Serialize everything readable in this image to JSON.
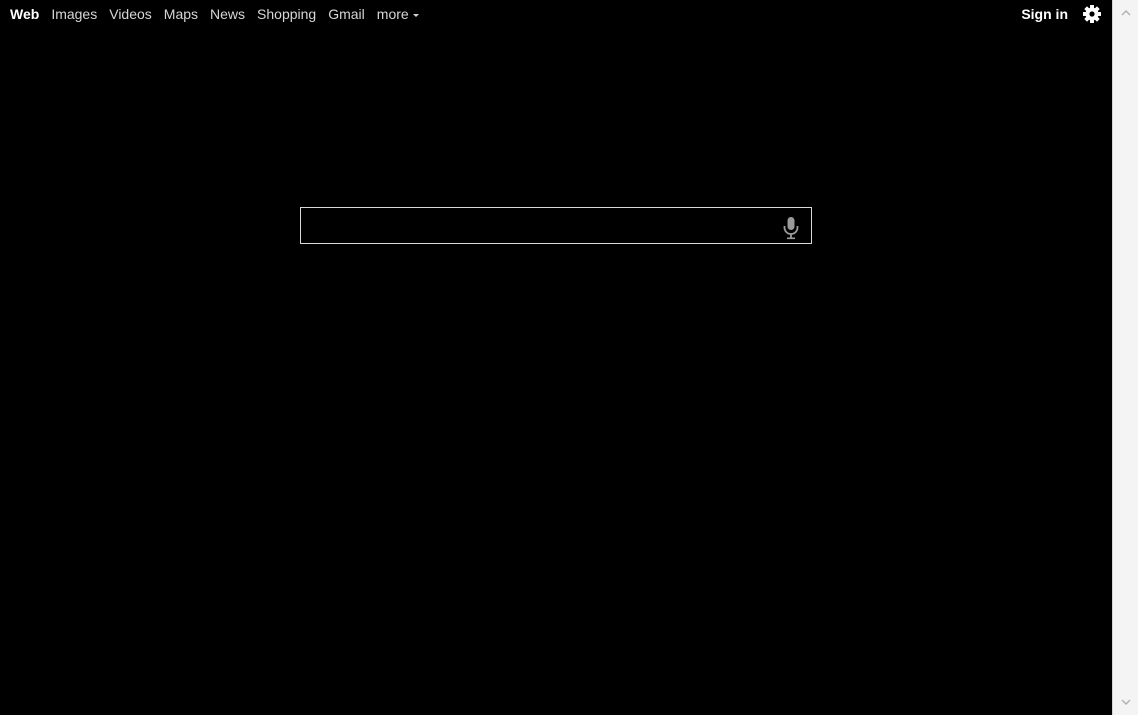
{
  "nav": {
    "items": [
      {
        "label": "Web",
        "active": true
      },
      {
        "label": "Images",
        "active": false
      },
      {
        "label": "Videos",
        "active": false
      },
      {
        "label": "Maps",
        "active": false
      },
      {
        "label": "News",
        "active": false
      },
      {
        "label": "Shopping",
        "active": false
      },
      {
        "label": "Gmail",
        "active": false
      }
    ],
    "more_label": "more"
  },
  "header": {
    "signin_label": "Sign in",
    "settings_icon": "gear-icon"
  },
  "search": {
    "value": "",
    "placeholder": "",
    "mic_icon": "microphone-icon"
  },
  "colors": {
    "background": "#000000",
    "nav_text": "#d6d6d6",
    "active_text": "#ffffff",
    "search_border": "#d9d9d9",
    "scrollbar_bg": "#f4f4f4"
  }
}
